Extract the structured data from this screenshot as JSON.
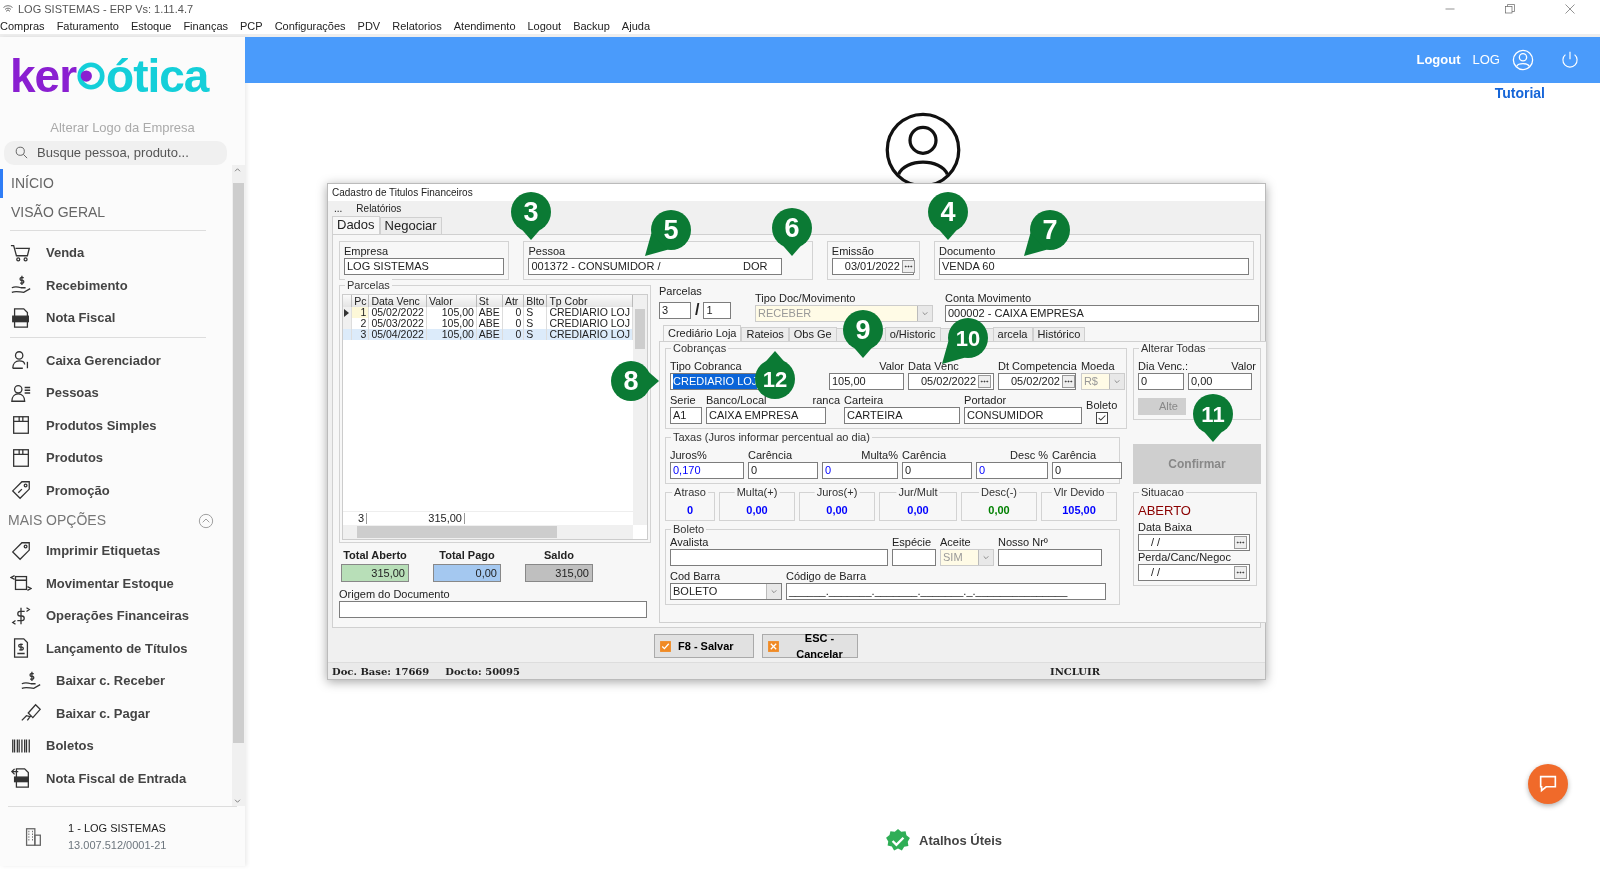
{
  "window": {
    "title": "LOG SISTEMAS - ERP Vs: 1.11.4.7"
  },
  "menu": [
    "Compras",
    "Faturamento",
    "Estoque",
    "Finanças",
    "PCP",
    "Configurações",
    "PDV",
    "Relatorios",
    "Atendimento",
    "Logout",
    "Backup",
    "Ajuda"
  ],
  "sidebar": {
    "logo": {
      "left": "ker",
      "right": "ótica"
    },
    "change_logo": "Alterar Logo da Empresa",
    "search": {
      "placeholder": "Busque pessoa, produto..."
    },
    "nav": [
      {
        "label": "INÍCIO",
        "selected": true
      },
      {
        "label": "VISÃO GERAL",
        "selected": false
      }
    ],
    "groups": [
      {
        "items": [
          {
            "label": "Venda"
          },
          {
            "label": "Recebimento"
          },
          {
            "label": "Nota Fiscal"
          }
        ]
      },
      {
        "items": [
          {
            "label": "Caixa Gerenciador"
          },
          {
            "label": "Pessoas"
          },
          {
            "label": "Produtos Simples"
          },
          {
            "label": "Produtos"
          },
          {
            "label": "Promoção"
          }
        ]
      },
      {
        "title": "MAIS OPÇÕES",
        "expanded": true,
        "items": [
          {
            "label": "Imprimir Etiquetas"
          },
          {
            "label": "Movimentar Estoque"
          },
          {
            "label": "Operações Financeiras"
          },
          {
            "label": "Lançamento de Títulos",
            "children": [
              {
                "label": "Baixar c. Receber"
              },
              {
                "label": "Baixar c. Pagar"
              }
            ]
          },
          {
            "label": "Boletos"
          },
          {
            "label": "Nota Fiscal de Entrada"
          }
        ]
      }
    ],
    "company": {
      "name": "1 - LOG SISTEMAS",
      "cnpj": "13.007.512/0001-21"
    }
  },
  "header": {
    "logout": "Logout",
    "user": "LOG"
  },
  "tutorial": "Tutorial",
  "dialog": {
    "title": "Cadastro de Titulos Financeiros",
    "menu": [
      "...",
      "Relatórios"
    ],
    "tabs": [
      {
        "label": "Dados",
        "selected": true
      },
      {
        "label": "Negociar",
        "selected": false
      }
    ],
    "empresa": {
      "label": "Empresa",
      "value": "LOG SISTEMAS"
    },
    "pessoa": {
      "label": "Pessoa",
      "value": "001372 - CONSUMIDOR /",
      "value_tail": "DOR"
    },
    "emissao": {
      "label": "Emissão",
      "value": "03/01/2022"
    },
    "documento": {
      "label": "Documento",
      "value": "VENDA 60"
    },
    "grid": {
      "title": "Parcelas",
      "columns": [
        "Pc",
        "Data Venc",
        "Valor",
        "St",
        "Atr",
        "Blto",
        "Tp Cobr"
      ],
      "rows": [
        {
          "cells": [
            "1",
            "05/02/2022",
            "105,00",
            "ABE",
            "0",
            "S",
            "CREDIARIO LOJ"
          ],
          "current": true,
          "selected": false
        },
        {
          "cells": [
            "2",
            "05/03/2022",
            "105,00",
            "ABE",
            "0",
            "S",
            "CREDIARIO LOJ"
          ],
          "current": false,
          "selected": false
        },
        {
          "cells": [
            "3",
            "05/04/2022",
            "105,00",
            "ABE",
            "0",
            "S",
            "CREDIARIO LOJ"
          ],
          "current": false,
          "selected": true
        }
      ],
      "footer": {
        "count": "3",
        "valor": "315,00"
      }
    },
    "totals": [
      {
        "label": "Total Aberto",
        "value": "315,00",
        "color": "#b8dfb8"
      },
      {
        "label": "Total Pago",
        "value": "0,00",
        "color": "#a4c8f0"
      },
      {
        "label": "Saldo",
        "value": "315,00",
        "color": "#bfbfbf"
      }
    ],
    "origem": {
      "label": "Origem do Documento"
    },
    "parcelas": {
      "label": "Parcelas",
      "total": "3",
      "separator": "/",
      "current": "1"
    },
    "tipo_doc": {
      "label": "Tipo Doc/Movimento",
      "value": "RECEBER",
      "disabled": true
    },
    "conta": {
      "label": "Conta Movimento",
      "value": "000002 - CAIXA EMPRESA"
    },
    "subtabs": [
      {
        "label": "Crediário Loja",
        "selected": true
      },
      {
        "label": "Rateios",
        "selected": false
      },
      {
        "label": "Obs Ge",
        "selected": false
      },
      {
        "label": "o/Historic",
        "selected": false
      },
      {
        "label": "arcela",
        "selected": false
      },
      {
        "label": "Histórico",
        "selected": false
      }
    ],
    "cobrancas": {
      "title": "Cobranças",
      "tipo_cobranca": {
        "label": "Tipo Cobranca",
        "value": "CREDIARIO LOJ",
        "highlighted": true
      },
      "valor": {
        "label": "Valor",
        "value": "105,00"
      },
      "data_venc": {
        "label": "Data Venc",
        "value": "05/02/2022"
      },
      "dt_competencia": {
        "label": "Dt Competencia",
        "value": "05/02/202"
      },
      "moeda": {
        "label": "Moeda",
        "value": "R$",
        "disabled": true
      },
      "serie": {
        "label": "Serie",
        "value": "A1"
      },
      "banco": {
        "label": "Banco/Local",
        "label_tail": "ranca",
        "value": "CAIXA EMPRESA"
      },
      "carteira": {
        "label": "Carteira",
        "value": "CARTEIRA"
      },
      "portador": {
        "label": "Portador",
        "value": "CONSUMIDOR"
      },
      "boleto": {
        "label": "Boleto",
        "checked": true
      }
    },
    "alterar_todas": {
      "title": "Alterar Todas",
      "dia_venc": {
        "label": "Dia Venc.:",
        "value": "0"
      },
      "valor": {
        "label": "Valor",
        "value": "0,00"
      },
      "button": {
        "label": "Alte",
        "disabled": true
      }
    },
    "confirmar": {
      "label": "Confirmar",
      "disabled": true
    },
    "taxas": {
      "title": "Taxas (Juros informar percentual ao dia)",
      "fields": [
        {
          "label": "Juros%",
          "value": "0,170",
          "kind": "rate"
        },
        {
          "label": "Carência",
          "value": "0",
          "kind": "days"
        },
        {
          "label": "Multa%",
          "value": "0",
          "kind": "rate"
        },
        {
          "label": "Carência",
          "value": "0",
          "kind": "days"
        },
        {
          "label": "Desc %",
          "value": "0",
          "kind": "rate"
        },
        {
          "label": "Carência",
          "value": "0",
          "kind": "days"
        }
      ]
    },
    "summary": [
      {
        "label": "Atraso",
        "value": "0",
        "color": "#0000ff"
      },
      {
        "label": "Multa(+)",
        "value": "0,00",
        "color": "#0000ff"
      },
      {
        "label": "Juros(+)",
        "value": "0,00",
        "color": "#0000ff"
      },
      {
        "label": "Jur/Mult",
        "value": "0,00",
        "color": "#0000ff"
      },
      {
        "label": "Desc(-)",
        "value": "0,00",
        "color": "#008000"
      },
      {
        "label": "Vlr Devido",
        "value": "105,00",
        "color": "#0000ff"
      }
    ],
    "situacao": {
      "title": "Situacao",
      "status": "ABERTO",
      "data_baixa": {
        "label": "Data Baixa",
        "value": "/  /"
      },
      "perda": {
        "label": "Perda/Canc/Negoc",
        "value": "/  /"
      }
    },
    "boleto": {
      "title": "Boleto",
      "avalista": {
        "label": "Avalista"
      },
      "especie": {
        "label": "Espécie"
      },
      "aceite": {
        "label": "Aceite",
        "value": "SIM",
        "disabled": true
      },
      "nosso_nr": {
        "label": "Nosso Nrº"
      },
      "cod_barra": {
        "label": "Cod Barra",
        "value": "BOLETO"
      },
      "codigo": {
        "label": "Código de Barra",
        "value": "______._______._______._______._._______________"
      }
    },
    "buttons": [
      {
        "label": "F8 - Salvar",
        "kind": "save"
      },
      {
        "label": "ESC - Cancelar",
        "kind": "cancel"
      }
    ],
    "status": {
      "doc_base": "Doc. Base: 17669",
      "docto": "Docto: 50095",
      "mode": "INCLUIR"
    },
    "markers": [
      {
        "number": "3"
      },
      {
        "number": "4"
      },
      {
        "number": "5"
      },
      {
        "number": "6"
      },
      {
        "number": "7"
      },
      {
        "number": "8"
      },
      {
        "number": "9"
      },
      {
        "number": "10"
      },
      {
        "number": "11"
      },
      {
        "number": "12"
      }
    ]
  },
  "shortcuts": "Atalhos Úteis"
}
